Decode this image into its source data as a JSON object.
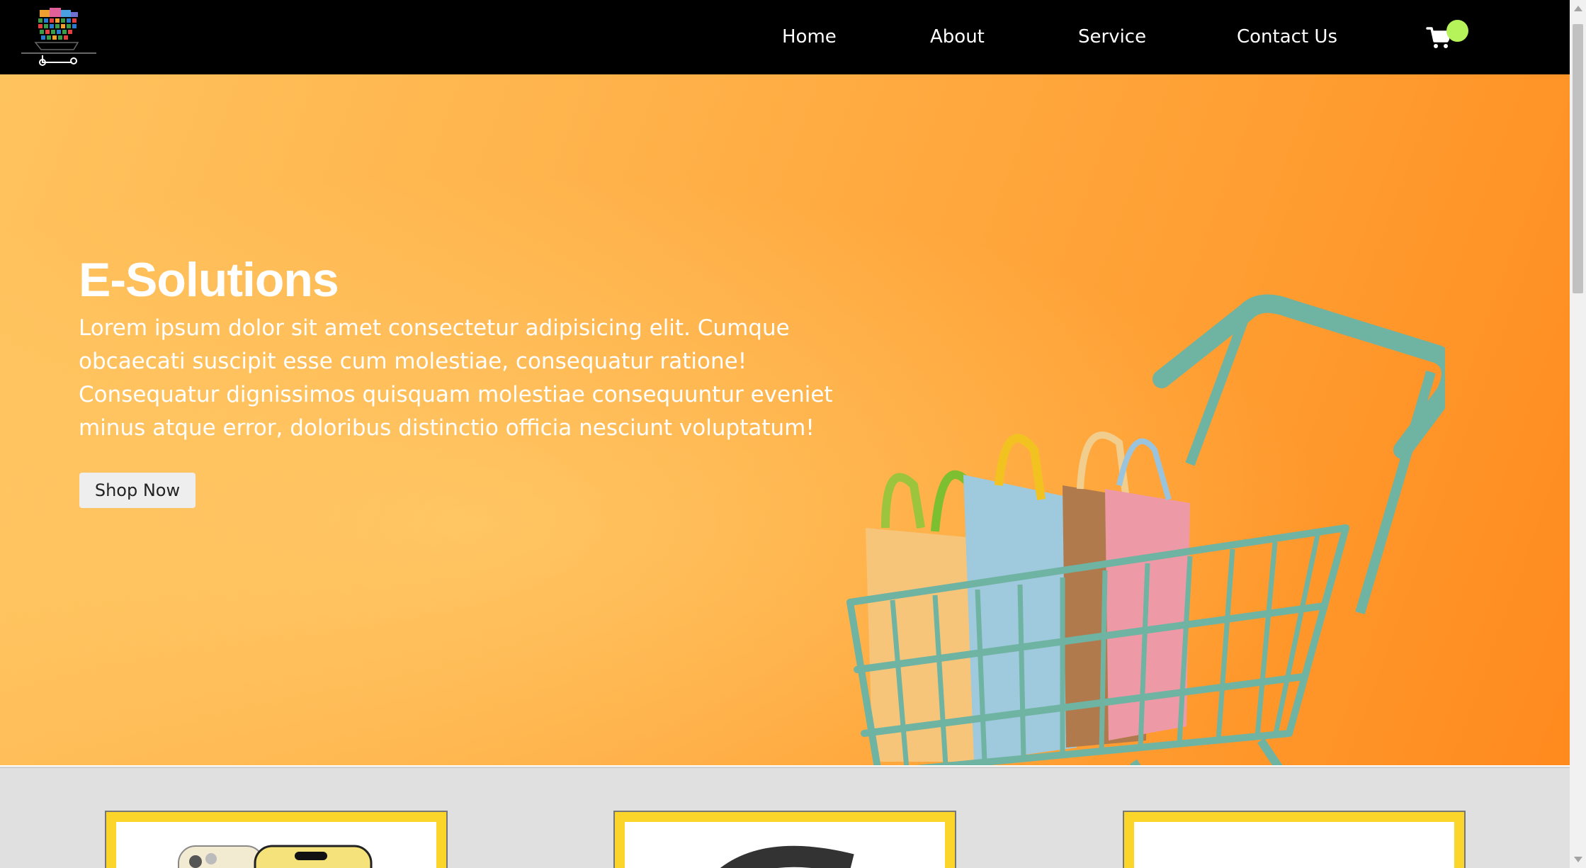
{
  "nav": {
    "links": [
      {
        "label": "Home"
      },
      {
        "label": "About"
      },
      {
        "label": "Service"
      },
      {
        "label": "Contact Us"
      }
    ],
    "cart_icon": "shopping-cart-icon",
    "badge_color": "#b6f25a"
  },
  "hero": {
    "title": "E-Solutions",
    "text": "Lorem ipsum dolor sit amet consectetur adipisicing elit. Cumque obcaecati suscipit esse cum molestiae, consequatur ratione! Consequatur dignissimos quisquam molestiae consequuntur eveniet minus atque error, doloribus distinctio officia nesciunt voluptatum!",
    "button_label": "Shop Now",
    "gradient_colors": [
      "#ffc35e",
      "#ff8a1e"
    ]
  },
  "products": {
    "card_border_color": "#fbd52a",
    "items": [
      {
        "image": "phone-image"
      },
      {
        "image": "headphones-image"
      },
      {
        "image": "blank-image"
      }
    ]
  }
}
